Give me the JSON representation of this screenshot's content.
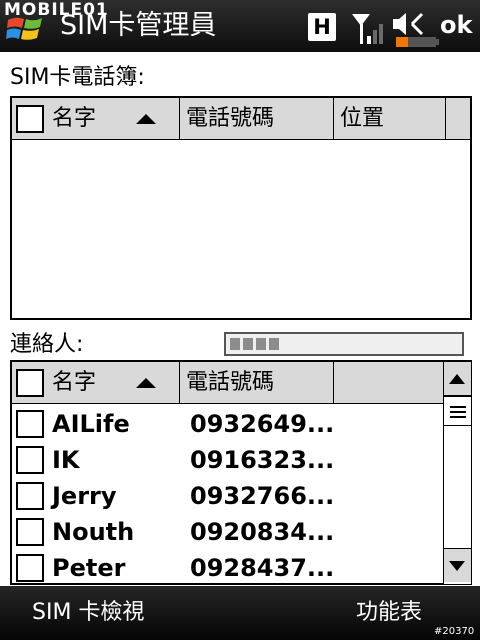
{
  "watermark": "MOBILE01",
  "status_bar": {
    "app_title": "SIM卡管理員",
    "network_label": "H",
    "ok_label": "ok",
    "icons": [
      "windows-start-icon",
      "signal-strength-icon",
      "volume-muted-icon",
      "battery-icon"
    ]
  },
  "sim_phonebook": {
    "label": "SIM卡電話簿:",
    "columns": [
      "名字",
      "電話號碼",
      "位置"
    ],
    "rows": []
  },
  "contacts": {
    "label": "連絡人:",
    "loading_progress": 0.25,
    "columns": [
      "名字",
      "電話號碼"
    ],
    "rows": [
      {
        "name": "AILife",
        "phone": "0932649..."
      },
      {
        "name": "IK",
        "phone": "0916323..."
      },
      {
        "name": "Jerry",
        "phone": "0932766..."
      },
      {
        "name": "Nouth",
        "phone": "0920834..."
      },
      {
        "name": "Peter",
        "phone": "0928437..."
      }
    ]
  },
  "softkeys": {
    "left": "SIM 卡檢視",
    "right": "功能表"
  },
  "photo_id": "#20370",
  "colors": {
    "bar_background": "#111111",
    "header_background": "#d9d9d9",
    "battery_accent": "#f07800"
  }
}
